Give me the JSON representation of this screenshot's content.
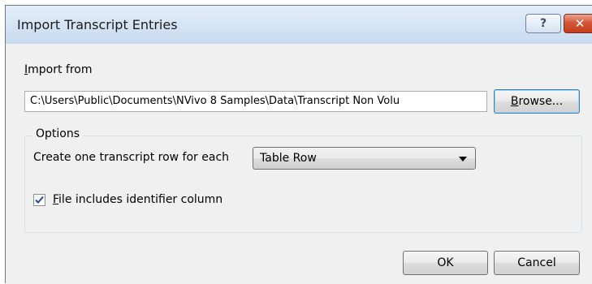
{
  "window": {
    "title": "Import Transcript Entries",
    "help_glyph": "?",
    "close_glyph": "✕"
  },
  "import_from": {
    "label_access": "I",
    "label_rest": "mport from",
    "path_value": "C:\\Users\\Public\\Documents\\NVivo 8 Samples\\Data\\Transcript Non Volu",
    "browse_access": "B",
    "browse_rest": "rowse..."
  },
  "options": {
    "group_title": "Options",
    "row_label": "Create one transcript row for each",
    "row_selected": "Table Row",
    "checkbox_checked": true,
    "checkbox_access": "F",
    "checkbox_rest": "ile includes identifier column"
  },
  "buttons": {
    "ok": "OK",
    "cancel": "Cancel"
  },
  "colors": {
    "client_bg": "#f0f0f0",
    "title_bg": "#d4e3f4",
    "close_red": "#c43d1c",
    "focus_blue": "#3c7fb1"
  }
}
